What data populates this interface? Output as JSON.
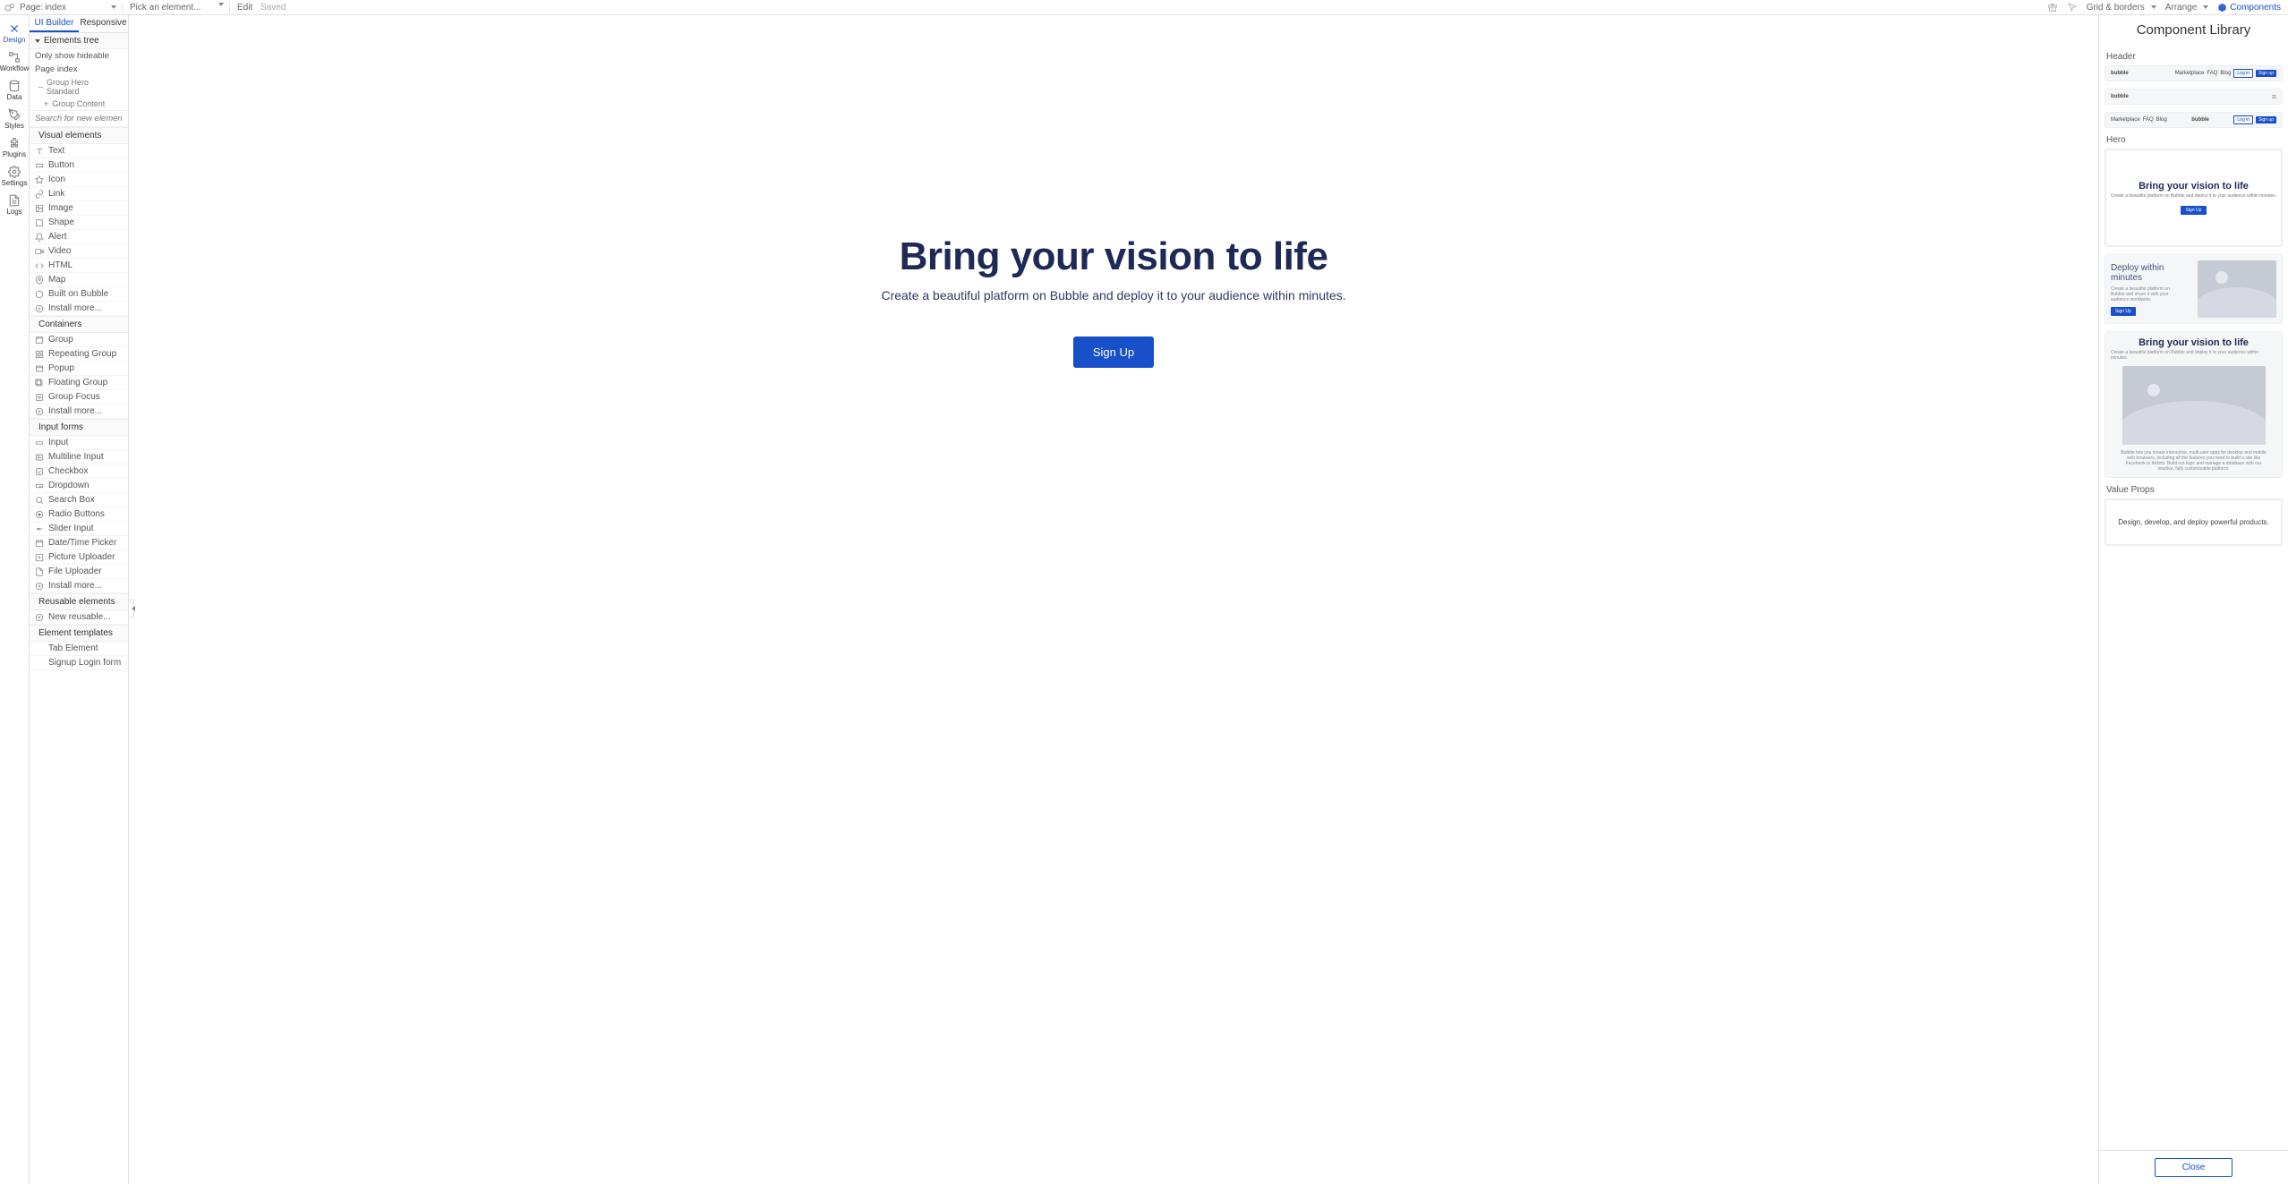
{
  "top": {
    "page_label": "Page:",
    "page_name": "index",
    "pick_placeholder": "Pick an element...",
    "edit": "Edit",
    "saved": "Saved",
    "grid": "Grid & borders",
    "arrange": "Arrange",
    "components": "Components"
  },
  "rail": [
    {
      "id": "design",
      "label": "Design"
    },
    {
      "id": "workflow",
      "label": "Workflow"
    },
    {
      "id": "data",
      "label": "Data"
    },
    {
      "id": "styles",
      "label": "Styles"
    },
    {
      "id": "plugins",
      "label": "Plugins"
    },
    {
      "id": "settings",
      "label": "Settings"
    },
    {
      "id": "logs",
      "label": "Logs"
    }
  ],
  "lp": {
    "tabs": {
      "ui": "UI Builder",
      "resp": "Responsive"
    },
    "elements_tree": "Elements tree",
    "only_hideable": "Only show hideable",
    "tree": {
      "page": "Page index",
      "g1": "Group Hero Standard",
      "g2": "Group Content"
    },
    "search_ph": "Search for new elements...",
    "visual_head": "Visual elements",
    "visual": [
      "Text",
      "Button",
      "Icon",
      "Link",
      "Image",
      "Shape",
      "Alert",
      "Video",
      "HTML",
      "Map",
      "Built on Bubble",
      "Install more..."
    ],
    "containers_head": "Containers",
    "containers": [
      "Group",
      "Repeating Group",
      "Popup",
      "Floating Group",
      "Group Focus",
      "Install more..."
    ],
    "inputs_head": "Input forms",
    "inputs": [
      "Input",
      "Multiline Input",
      "Checkbox",
      "Dropdown",
      "Search Box",
      "Radio Buttons",
      "Slider Input",
      "Date/Time Picker",
      "Picture Uploader",
      "File Uploader",
      "Install more..."
    ],
    "reusable_head": "Reusable elements",
    "reusable": [
      "New reusable..."
    ],
    "templates_head": "Element templates",
    "templates": [
      "Tab Element",
      "Signup Login form"
    ]
  },
  "hero": {
    "title": "Bring your vision to life",
    "subtitle": "Create a beautiful platform on Bubble and deploy it to your audience within minutes.",
    "cta": "Sign Up"
  },
  "lib": {
    "title": "Component Library",
    "sections": {
      "header": "Header",
      "hero": "Hero",
      "value": "Value Props"
    },
    "header_cards": {
      "logo": "bubble",
      "nav": [
        "Marketplace",
        "FAQ",
        "Blog"
      ],
      "login": "Log in",
      "signup": "Sign up",
      "hamburger": "≡"
    },
    "hero_cards": {
      "h1_title": "Bring your vision to life",
      "h1_sub": "Create a beautiful platform on Bubble and deploy it to your audience within minutes.",
      "h1_btn": "Sign Up",
      "h2_title": "Deploy within minutes",
      "h2_sub": "Create a beautiful platform on Bubble and share it with your audience worldwide.",
      "h2_btn": "Sign Up",
      "h3_title": "Bring your vision to life",
      "h3_sub": "Create a beautiful platform on Bubble and deploy it to your audience within minutes.",
      "h3_desc": "Bubble lets you create interactive, multi-user apps for desktop and mobile web browsers, including all the features you need to build a site like Facebook or Airbnb. Build out logic and manage a database with our intuitive, fully customizable platform."
    },
    "vp_text": "Design, develop, and deploy powerful products.",
    "close": "Close"
  }
}
